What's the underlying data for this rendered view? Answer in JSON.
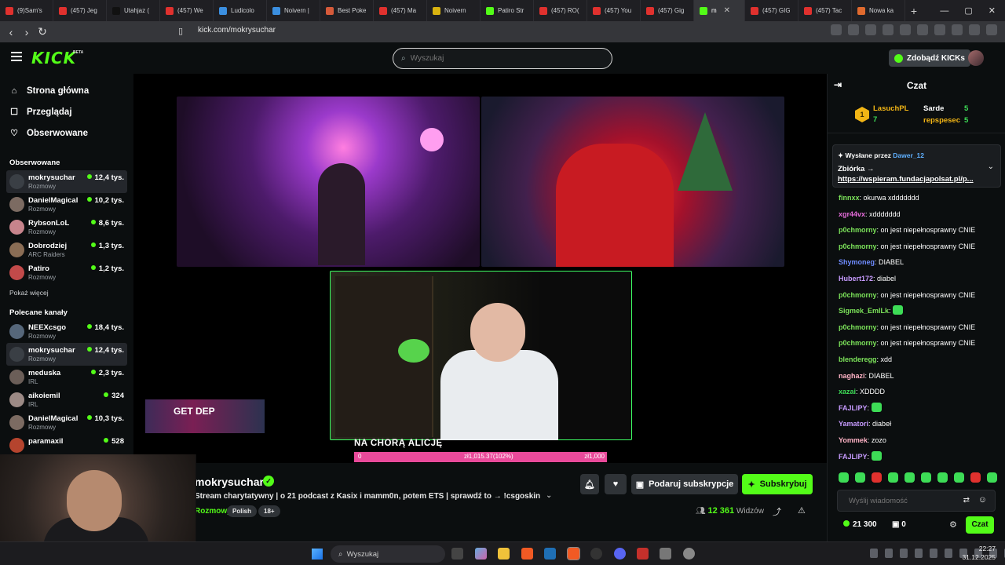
{
  "browser": {
    "tabs": [
      {
        "label": "(9)Sam's",
        "color": "#e0312e"
      },
      {
        "label": "(457) Jeg",
        "color": "#e0312e"
      },
      {
        "label": "Utahjaz (",
        "color": "#111111"
      },
      {
        "label": "(457) We",
        "color": "#e0312e"
      },
      {
        "label": "Ludicolo",
        "color": "#3b8fe0"
      },
      {
        "label": "Noivern |",
        "color": "#3b8fe0"
      },
      {
        "label": "Best Poke",
        "color": "#d65a3a"
      },
      {
        "label": "(457) Ma",
        "color": "#e0312e"
      },
      {
        "label": "Noivern",
        "color": "#d9b310"
      },
      {
        "label": "Patiro Str",
        "color": "#53fc18"
      },
      {
        "label": "(457) RO(",
        "color": "#e0312e"
      },
      {
        "label": "(457) You",
        "color": "#e0312e"
      },
      {
        "label": "(457) Gig",
        "color": "#e0312e"
      },
      {
        "label": "m",
        "color": "#53fc18",
        "active": true
      },
      {
        "label": "(457) GIG",
        "color": "#e0312e"
      },
      {
        "label": "(457) Tac",
        "color": "#e0312e"
      },
      {
        "label": "Nowa ka",
        "color": "#e06a2e"
      }
    ],
    "url": "kick.com/mokrysuchar",
    "new_tab": "+",
    "window_controls": {
      "minimize": "—",
      "maximize": "▢",
      "close": "✕"
    }
  },
  "header": {
    "logo": "KICK",
    "beta": "BETA",
    "search_placeholder": "Wyszukaj",
    "get_kicks": "Zdobądź KICKs"
  },
  "sidebar": {
    "nav": [
      {
        "label": "Strona główna",
        "icon": "⌂"
      },
      {
        "label": "Przeglądaj",
        "icon": "☐"
      },
      {
        "label": "Obserwowane",
        "icon": "♡"
      }
    ],
    "following_title": "Obserwowane",
    "following": [
      {
        "name": "mokrysuchar",
        "category": "Rozmowy",
        "viewers": "12,4 tys.",
        "selected": true,
        "avatar": "#3a3f45"
      },
      {
        "name": "DanielMagical",
        "category": "Rozmowy",
        "viewers": "10,2 tys.",
        "avatar": "#7c6b62"
      },
      {
        "name": "RybsonLoL",
        "category": "Rozmowy",
        "viewers": "8,6 tys.",
        "avatar": "#c7848c"
      },
      {
        "name": "Dobrodziej",
        "category": "ARC Raiders",
        "viewers": "1,3 tys.",
        "avatar": "#8a6d55"
      },
      {
        "name": "Patiro",
        "category": "Rozmowy",
        "viewers": "1,2 tys.",
        "avatar": "#c24a4a"
      }
    ],
    "show_more": "Pokaż więcej",
    "recommended_title": "Polecane kanały",
    "recommended": [
      {
        "name": "NEEXcsgo",
        "category": "Rozmowy",
        "viewers": "18,4 tys.",
        "avatar": "#56677a"
      },
      {
        "name": "mokrysuchar",
        "category": "Rozmowy",
        "viewers": "12,4 tys.",
        "selected": true,
        "avatar": "#3a3f45"
      },
      {
        "name": "meduska",
        "category": "IRL",
        "viewers": "2,3 tys.",
        "avatar": "#6b5e58"
      },
      {
        "name": "aikoiemil",
        "category": "IRL",
        "viewers": "324",
        "avatar": "#9c8a85"
      },
      {
        "name": "DanielMagical",
        "category": "Rozmowy",
        "viewers": "10,3 tys.",
        "avatar": "#7c6b62"
      },
      {
        "name": "paramaxil",
        "category": "",
        "viewers": "528",
        "avatar": "#b5442e"
      }
    ]
  },
  "video": {
    "overlay_ad": "GET DEP",
    "goal_title": "NA CHORĄ ALICJĘ",
    "goal_min": "0",
    "goal_current": "zł1,015.37(102%)",
    "goal_target": "zł1,000",
    "goal_progress": 1.02
  },
  "stream": {
    "name": "mokrysuchar",
    "title": "Stream charytatywny | o 21 podcast z Kasix i mamm0n, potem ETS | sprawdź to → !csgoskins !fo...",
    "category": "Rozmowy",
    "tags": [
      "Polish",
      "18+"
    ],
    "viewers": "12 361",
    "viewers_label": "Widzów",
    "gift_label": "Podaruj subskrypcje",
    "subscribe_label": "Subskrybuj"
  },
  "chat": {
    "title": "Czat",
    "leaderboard": [
      {
        "rank": "1",
        "name": "LasuchPL",
        "value": "7"
      },
      {
        "name": "Sarde",
        "value": "5"
      },
      {
        "name": "repspesec",
        "value": "5"
      }
    ],
    "pinned": {
      "sent_by_label": "Wysłane przez",
      "sent_by": "Dawer_12",
      "title": "Zbiórka →",
      "link": "https://wspieram.fundacjapolsat.pl/p..."
    },
    "messages": [
      {
        "user": "finnxx",
        "color": "#7ce35a",
        "text": "okurwa xddddddd"
      },
      {
        "user": "xgr44vx",
        "color": "#e46bd9",
        "text": "xddddddd"
      },
      {
        "user": "p0chmorny",
        "color": "#7ce35a",
        "text": "on jest niepełnosprawny CNIE"
      },
      {
        "user": "p0chmorny",
        "color": "#7ce35a",
        "text": "on jest niepełnosprawny CNIE"
      },
      {
        "user": "Shymoneg",
        "color": "#6f8cff",
        "text": "DIABEL"
      },
      {
        "user": "Hubert172",
        "color": "#c79bff",
        "text": "diabel"
      },
      {
        "user": "p0chmorny",
        "color": "#7ce35a",
        "text": "on jest niepełnosprawny CNIE"
      },
      {
        "user": "Sigmek_EmILk",
        "color": "#7ce35a",
        "text": "",
        "emote": true
      },
      {
        "user": "p0chmorny",
        "color": "#7ce35a",
        "text": "on jest niepełnosprawny CNIE"
      },
      {
        "user": "p0chmorny",
        "color": "#7ce35a",
        "text": "on jest niepełnosprawny CNIE"
      },
      {
        "user": "blenderegg",
        "color": "#7ce35a",
        "text": "xdd"
      },
      {
        "user": "naghazi",
        "color": "#ffb3c6",
        "text": "DIABEL"
      },
      {
        "user": "xazai",
        "color": "#3ddc56",
        "text": "XDDDD"
      },
      {
        "user": "FAJLIPY",
        "color": "#c79bff",
        "text": "",
        "emote": true
      },
      {
        "user": "Yamatori",
        "color": "#c79bff",
        "text": "diabeł"
      },
      {
        "user": "Yommek",
        "color": "#ffb3c6",
        "text": "zozo"
      },
      {
        "user": "FAJLIPY",
        "color": "#c79bff",
        "text": "",
        "emote": true
      }
    ],
    "input_placeholder": "Wyślij wiadomość",
    "points": "21 300",
    "chests": "0",
    "send_label": "Czat"
  },
  "taskbar": {
    "search_placeholder": "Wyszukaj",
    "time": "22:27",
    "date": "31.12.2025"
  }
}
